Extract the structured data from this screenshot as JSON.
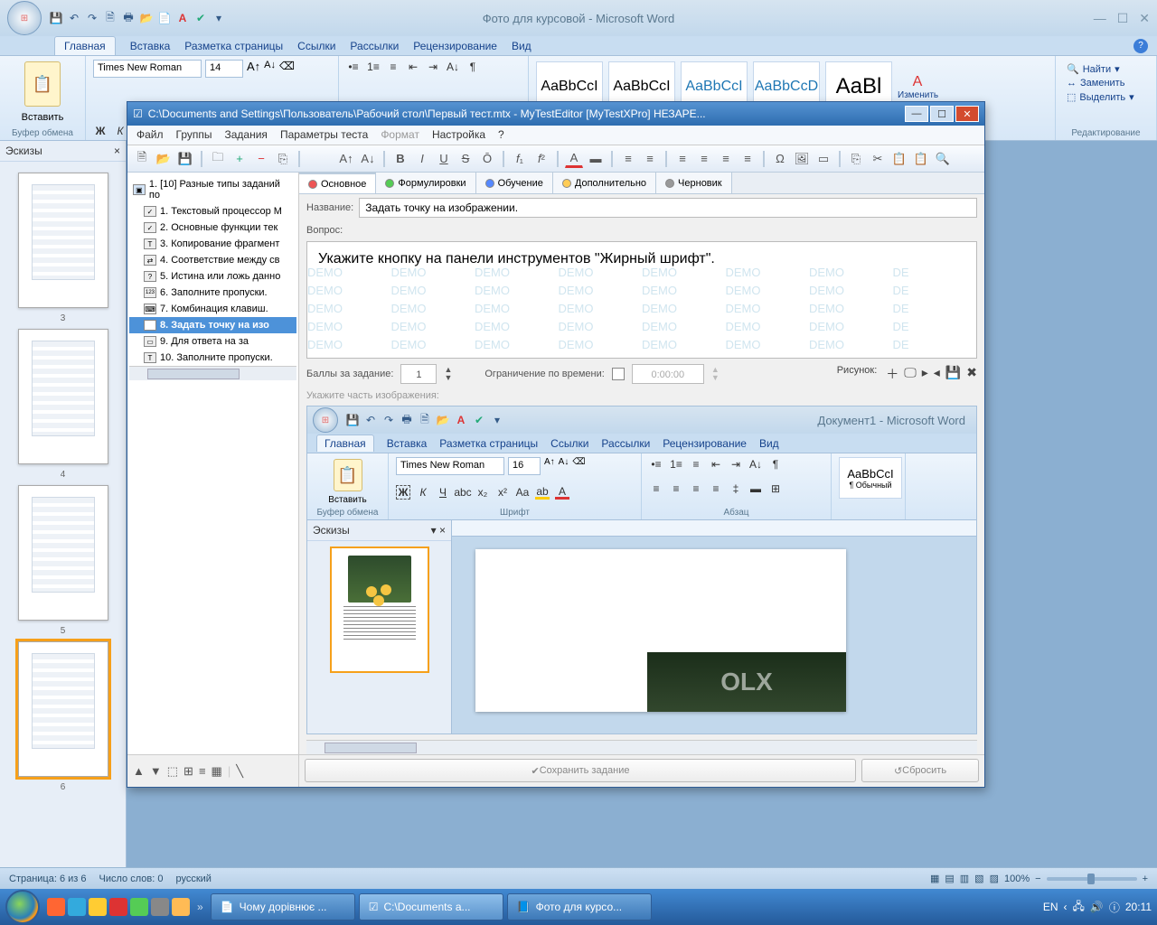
{
  "word": {
    "title": "Фото для курсовой - Microsoft Word",
    "tabs": [
      "Главная",
      "Вставка",
      "Разметка страницы",
      "Ссылки",
      "Рассылки",
      "Рецензирование",
      "Вид"
    ],
    "font_name": "Times New Roman",
    "font_size": "14",
    "clipboard": {
      "paste": "Вставить",
      "label": "Буфер обмена"
    },
    "styles_samples": [
      "AaBbCcI",
      "AaBbCcI",
      "AaBbCcI",
      "AaBbCcD",
      "AaBl"
    ],
    "change_styles": "Изменить",
    "editing": {
      "find": "Найти",
      "replace": "Заменить",
      "select": "Выделить",
      "label": "Редактирование"
    },
    "thumbs_header": "Эскизы",
    "thumb_numbers": [
      "3",
      "4",
      "5",
      "6"
    ],
    "status": {
      "page": "Страница: 6 из 6",
      "words": "Число слов: 0",
      "lang": "русский",
      "zoom": "100%"
    }
  },
  "mte": {
    "title": "C:\\Documents and Settings\\Пользователь\\Рабочий стол\\Первый тест.mtx - MyTestEditor [MyTestXPro] НЕЗАРЕ...",
    "menu": [
      "Файл",
      "Группы",
      "Задания",
      "Параметры теста",
      "Формат",
      "Настройка",
      "?"
    ],
    "tree_root": "1. [10] Разные типы заданий по",
    "tree": [
      "1. Текстовый процессор М",
      "2. Основные функции тек",
      "3. Копирование фрагмент",
      "4. Соответствие между св",
      "5. Истина или ложь данно",
      "6. Заполните пропуски.",
      "7. Комбинация клавиш.",
      "8. Задать точку на изо",
      "9. Для ответа на за",
      "10. Заполните пропуски."
    ],
    "tabs": [
      "Основное",
      "Формулировки",
      "Обучение",
      "Дополнительно",
      "Черновик"
    ],
    "name_label": "Название:",
    "name_value": "Задать точку на изображении.",
    "question_label": "Вопрос:",
    "question_text": "Укажите кнопку на панели инструментов \"Жирный шрифт\".",
    "points_label": "Баллы за задание:",
    "points_value": "1",
    "time_label": "Ограничение по времени:",
    "time_value": "0:00:00",
    "image_label": "Рисунок:",
    "image_part_label": "Укажите часть изображения:",
    "save_btn": "Сохранить задание",
    "reset_btn": "Сбросить"
  },
  "inner_word": {
    "title": "Документ1 - Microsoft Word",
    "tabs": [
      "Главная",
      "Вставка",
      "Разметка страницы",
      "Ссылки",
      "Рассылки",
      "Рецензирование",
      "Вид"
    ],
    "font_name": "Times New Roman",
    "font_size": "16",
    "clipboard": {
      "paste": "Вставить",
      "label": "Буфер обмена"
    },
    "font_label": "Шрифт",
    "para_label": "Абзац",
    "style_sample": "AaBbCcI",
    "style_name": "¶ Обычный",
    "thumbs_header": "Эскизы",
    "olx": "OLX"
  },
  "taskbar": {
    "tasks": [
      "Чому дорівнює ...",
      "C:\\Documents a...",
      "Фото для курсо..."
    ],
    "lang": "EN",
    "time": "20:11"
  }
}
